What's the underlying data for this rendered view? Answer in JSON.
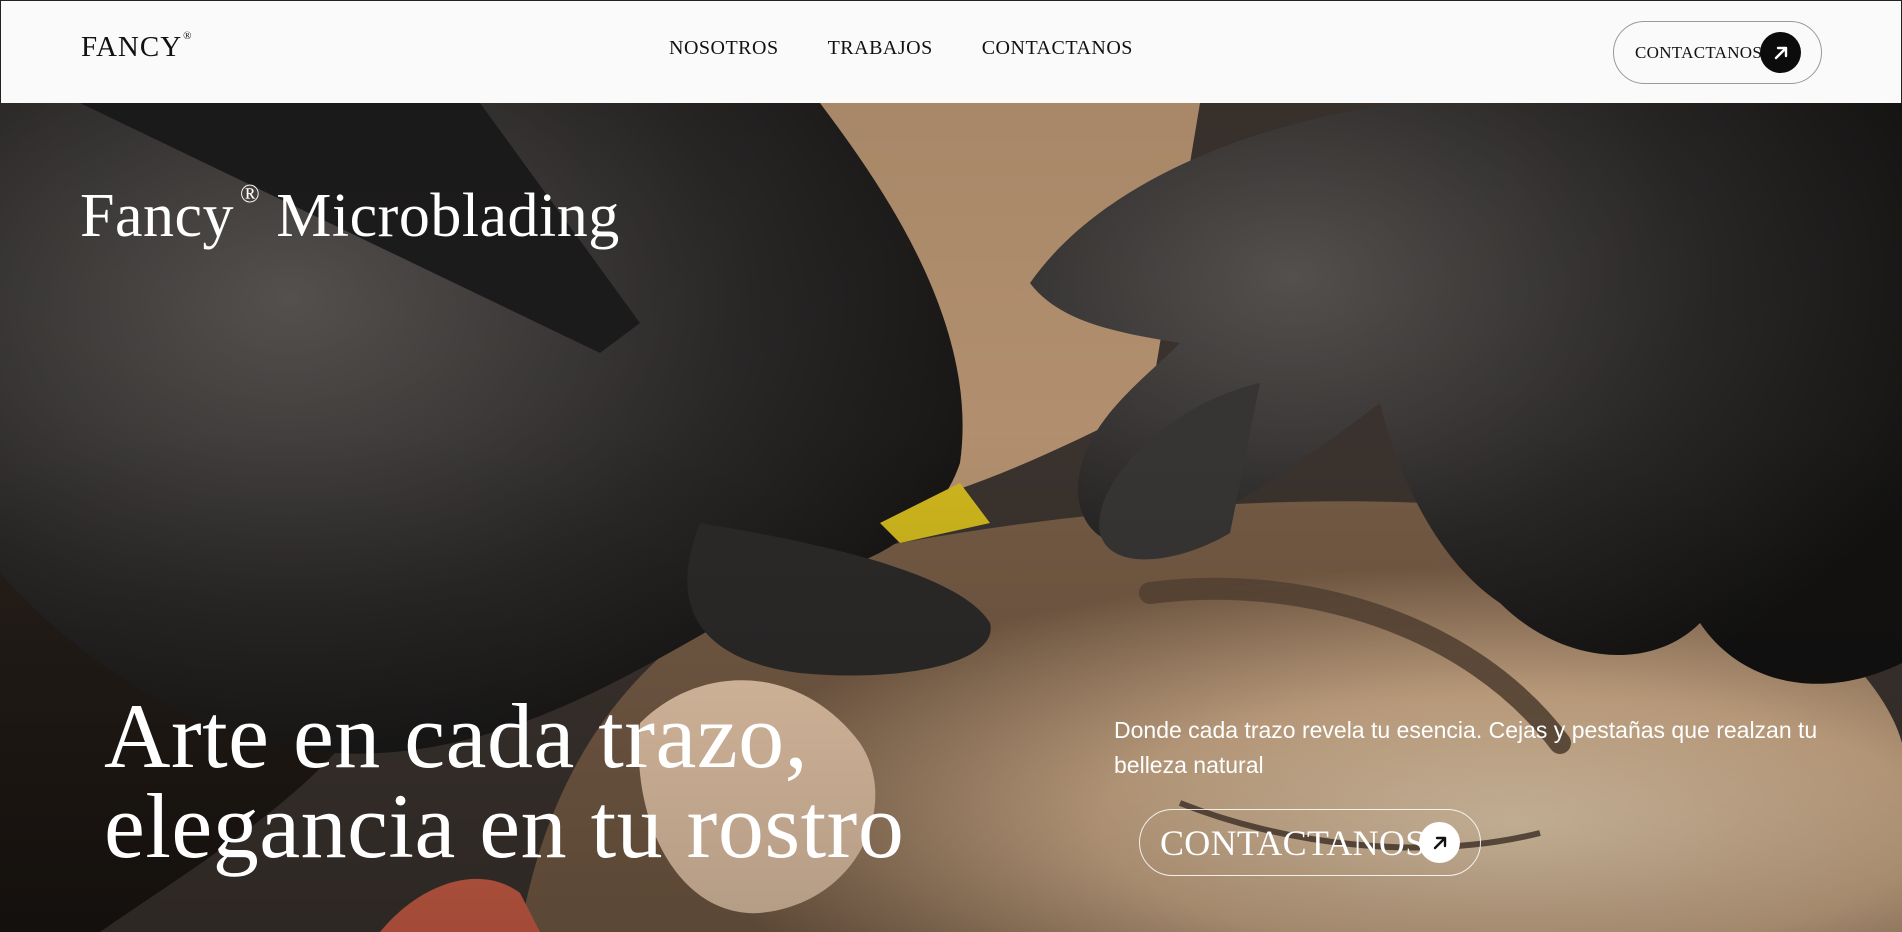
{
  "header": {
    "logo": "FANCY",
    "logo_mark": "®",
    "nav": [
      {
        "label": "NOSOTROS"
      },
      {
        "label": "TRABAJOS"
      },
      {
        "label": "CONTACTANOS"
      }
    ],
    "cta_label": "CONTACTANOS",
    "cta_icon": "arrow-up-right-icon"
  },
  "hero": {
    "brand_name": "Fancy",
    "brand_mark": "®",
    "brand_service": "Microblading",
    "headline_line1": "Arte en cada trazo,",
    "headline_line2": "elegancia en tu rostro",
    "description": "Donde cada trazo revela tu esencia. Cejas y pestañas que realzan tu belleza natural",
    "cta_label": "CONTACTANOS",
    "cta_icon": "arrow-up-right-icon"
  },
  "colors": {
    "header_bg": "#fafafa",
    "text_dark": "#111111",
    "cta_icon_dark": "#0c0c0c",
    "hero_text": "#ffffff"
  }
}
